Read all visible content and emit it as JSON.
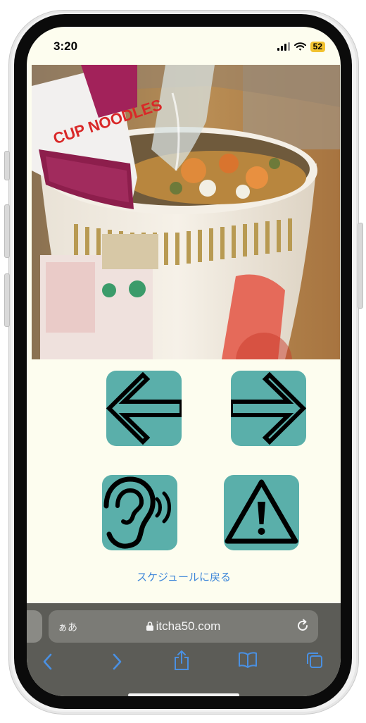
{
  "status": {
    "time": "3:20",
    "battery": "52"
  },
  "photo": {
    "cup_text": "CUP NOODLES"
  },
  "nav_buttons": {
    "prev": "arrow-left-icon",
    "next": "arrow-right-icon",
    "listen": "ear-icon",
    "warning": "warning-icon"
  },
  "colors": {
    "button": "#5aafaa",
    "page_bg": "#fdfdef",
    "link": "#3d86d9",
    "browser_bar": "#5c5c57"
  },
  "back_link": "スケジュールに戻る",
  "browser": {
    "aa_label": "ぁあ",
    "url": "itcha50.com"
  },
  "toolbar": [
    "back-icon",
    "forward-icon",
    "share-icon",
    "bookmarks-icon",
    "tabs-icon"
  ]
}
